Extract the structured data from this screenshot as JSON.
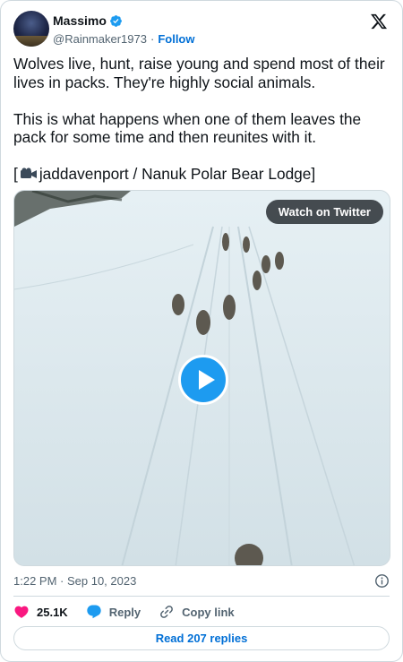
{
  "author": {
    "name": "Massimo",
    "handle": "@Rainmaker1973",
    "separator": "·",
    "follow_label": "Follow"
  },
  "tweet": {
    "line1": "Wolves live, hunt, raise young and spend most of their lives in packs. They're highly social animals.",
    "line2": "This is what happens when one of them leaves the pack for some time and then reunites with it.",
    "credit_open": "[",
    "credit_text": "jaddavenport / Nanuk Polar Bear Lodge]"
  },
  "media": {
    "watch_label": "Watch on Twitter"
  },
  "meta": {
    "timestamp": "1:22 PM · Sep 10, 2023"
  },
  "actions": {
    "likes": "25.1K",
    "reply_label": "Reply",
    "copy_label": "Copy link"
  },
  "replies_button": "Read 207 replies",
  "colors": {
    "accent": "#1d9bf0",
    "link": "#006fd6",
    "like": "#f91880",
    "muted": "#536471",
    "border": "#cfd9de"
  },
  "icons": [
    "verified-badge-icon",
    "x-logo-icon",
    "camera-icon",
    "play-icon",
    "info-icon",
    "heart-icon",
    "reply-icon",
    "link-icon"
  ]
}
